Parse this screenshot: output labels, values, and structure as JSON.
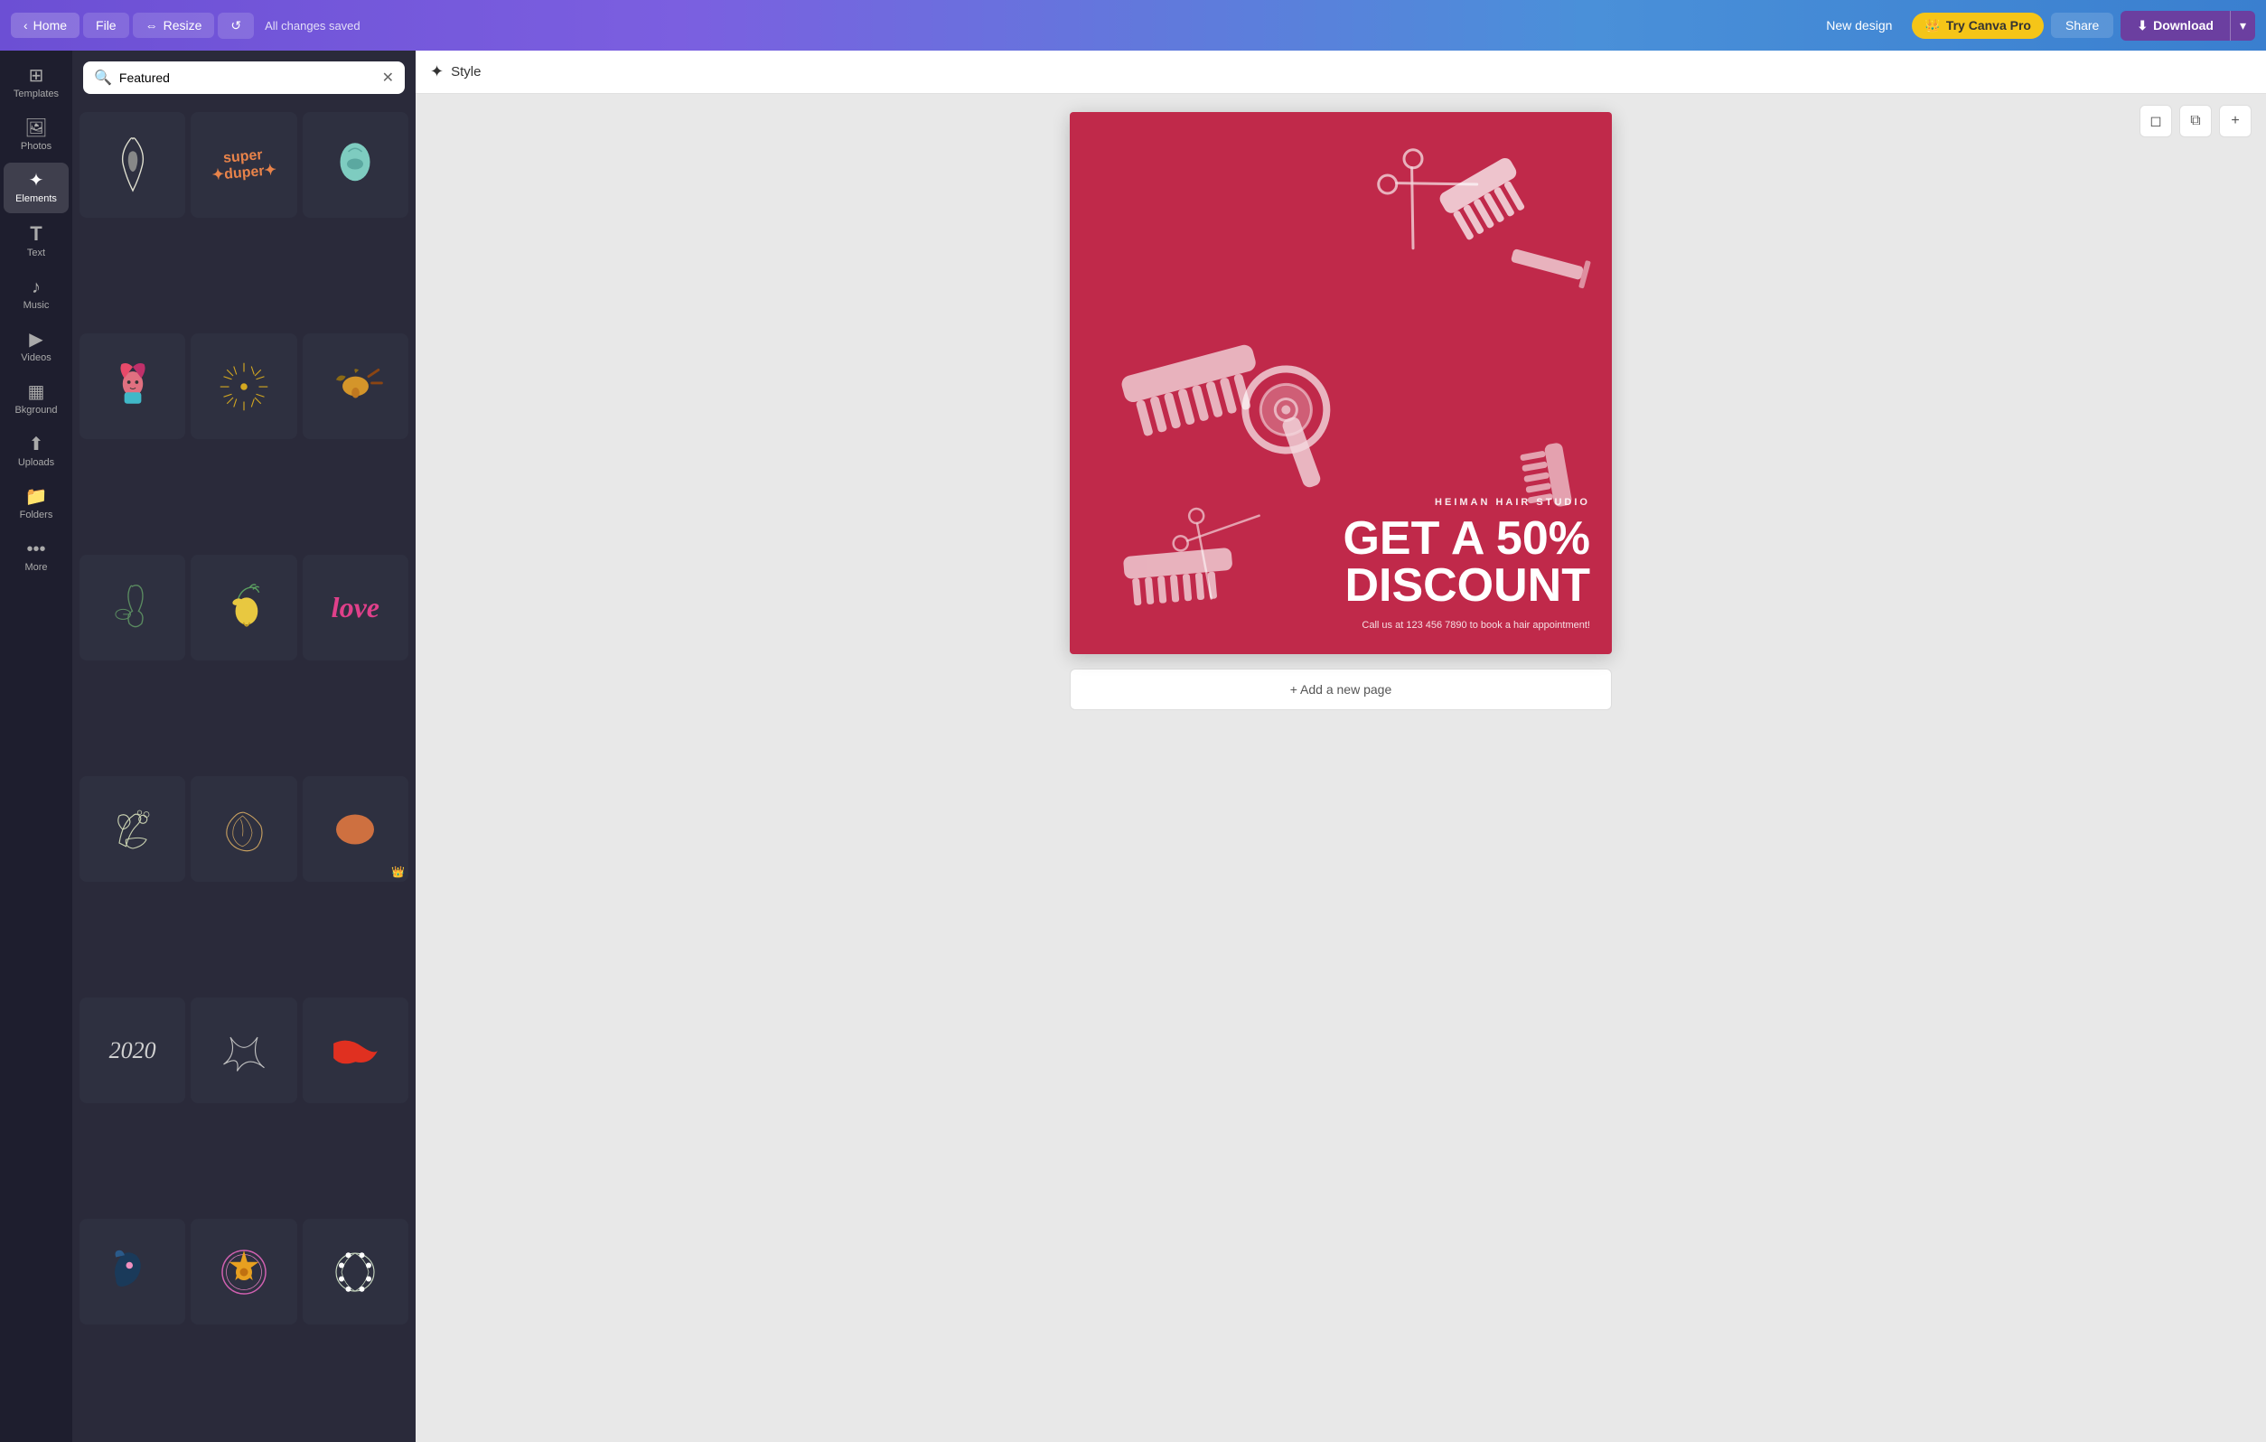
{
  "topnav": {
    "home_label": "Home",
    "file_label": "File",
    "resize_label": "Resize",
    "saved_text": "All changes saved",
    "new_design_label": "New design",
    "try_pro_label": "Try Canva Pro",
    "share_label": "Share",
    "download_label": "Download"
  },
  "sidebar": {
    "items": [
      {
        "id": "templates",
        "label": "Templates",
        "icon": "⊞"
      },
      {
        "id": "photos",
        "label": "Photos",
        "icon": "🖼"
      },
      {
        "id": "elements",
        "label": "Elements",
        "icon": "✦"
      },
      {
        "id": "text",
        "label": "Text",
        "icon": "T"
      },
      {
        "id": "music",
        "label": "Music",
        "icon": "♪"
      },
      {
        "id": "videos",
        "label": "Videos",
        "icon": "▶"
      },
      {
        "id": "background",
        "label": "Bkground",
        "icon": "▦"
      },
      {
        "id": "uploads",
        "label": "Uploads",
        "icon": "⬆"
      },
      {
        "id": "folders",
        "label": "Folders",
        "icon": "📁"
      },
      {
        "id": "more",
        "label": "More",
        "icon": "•••"
      }
    ]
  },
  "panel": {
    "search_placeholder": "Featured",
    "search_value": "Featured",
    "elements": [
      {
        "id": "e1",
        "emoji": "🦅",
        "bg": "#3a3a4a",
        "pro": false
      },
      {
        "id": "e2",
        "emoji": "✨",
        "bg": "#3a3a4a",
        "label": "super duper",
        "pro": false
      },
      {
        "id": "e3",
        "emoji": "🌿",
        "bg": "#3a3a4a",
        "pro": false
      },
      {
        "id": "e4",
        "emoji": "👩",
        "bg": "#3a3a4a",
        "pro": false
      },
      {
        "id": "e5",
        "emoji": "☀",
        "bg": "#3a3a4a",
        "pro": false
      },
      {
        "id": "e6",
        "emoji": "🦥",
        "bg": "#3a3a4a",
        "pro": false
      },
      {
        "id": "e7",
        "emoji": "🌱",
        "bg": "#3a3a4a",
        "pro": false
      },
      {
        "id": "e8",
        "emoji": "🍋",
        "bg": "#3a3a4a",
        "pro": false
      },
      {
        "id": "e9",
        "emoji": "💗",
        "bg": "#3a3a4a",
        "label": "love",
        "pro": false
      },
      {
        "id": "e10",
        "emoji": "🌸",
        "bg": "#3a3a4a",
        "pro": false
      },
      {
        "id": "e11",
        "emoji": "🐍",
        "bg": "#3a3a4a",
        "pro": false
      },
      {
        "id": "e12",
        "emoji": "🟤",
        "bg": "#3a3a4a",
        "pro": true
      },
      {
        "id": "e13",
        "emoji": "✏️",
        "bg": "#3a3a4a",
        "pro": false
      },
      {
        "id": "e14",
        "emoji": "🔀",
        "bg": "#3a3a4a",
        "pro": false
      },
      {
        "id": "e15",
        "emoji": "🔴",
        "bg": "#3a3a4a",
        "pro": false
      },
      {
        "id": "e16",
        "emoji": "🌊",
        "bg": "#3a3a4a",
        "label": "2020",
        "pro": false
      },
      {
        "id": "e17",
        "emoji": "🔵",
        "bg": "#3a3a4a",
        "pro": false
      },
      {
        "id": "e18",
        "emoji": "🌺",
        "bg": "#3a3a4a",
        "pro": false
      }
    ]
  },
  "style_bar": {
    "label": "Style",
    "icon": "✦"
  },
  "canvas": {
    "studio_name": "HEIMAN HAIR STUDIO",
    "discount_line1": "GET A 50%",
    "discount_line2": "DISCOUNT",
    "contact_text": "Call us at 123 456 7890 to book a\nhair appointment!",
    "add_page_label": "+ Add a new page",
    "bg_color": "#c0294a"
  },
  "colors": {
    "topnav_gradient_start": "#6c4fd4",
    "topnav_gradient_end": "#3a7fcf",
    "canvas_bg": "#c0294a",
    "sidebar_bg": "#1e1e2e",
    "panel_bg": "#2a2a3a"
  }
}
